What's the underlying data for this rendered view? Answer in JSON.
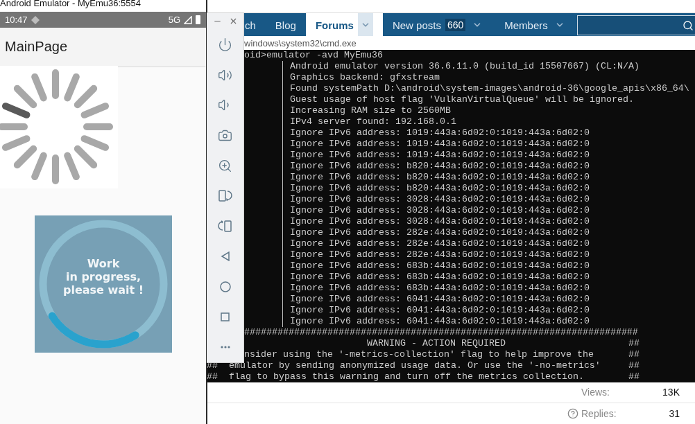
{
  "emulator": {
    "title": "Android Emulator - MyEmu36:5554",
    "status_time": "10:47",
    "network": "5G",
    "app_title": "MainPage",
    "progress_image": {
      "lines": [
        "Work",
        "in progress,",
        "please wait !"
      ]
    }
  },
  "browser": {
    "nav": [
      {
        "label": "ch",
        "selected": false,
        "dropdown": false
      },
      {
        "label": "Blog",
        "selected": false,
        "dropdown": false
      },
      {
        "label": "Forums",
        "selected": true,
        "dropdown": true
      },
      {
        "label": "New posts",
        "selected": false,
        "dropdown": true,
        "badge": "660"
      },
      {
        "label": "Members",
        "selected": false,
        "dropdown": true
      }
    ],
    "stats": [
      {
        "label": "Views:",
        "value": "13K",
        "help": false
      },
      {
        "label": "Replies:",
        "value": "31",
        "help": true
      }
    ]
  },
  "cmd": {
    "title": "windows\\system32\\cmd.exe",
    "lines": [
      {
        "kind": "command",
        "text": "oid>emulator -avd MyEmu36"
      },
      {
        "kind": "log",
        "text": "Android emulator version 36.6.11.0 (build_id 15507667) (CL:N/A)"
      },
      {
        "kind": "log",
        "text": "Graphics backend: gfxstream"
      },
      {
        "kind": "log",
        "text": "Found systemPath D:\\android\\system-images\\android-36\\google_apis\\x86_64\\"
      },
      {
        "kind": "log",
        "text": "Guest usage of host flag 'VulkanVirtualQueue' will be ignored."
      },
      {
        "kind": "log",
        "text": "Increasing RAM size to 2560MB"
      },
      {
        "kind": "log",
        "text": "IPv4 server found: 192.168.0.1"
      },
      {
        "kind": "log",
        "text": "Ignore IPv6 address: 1019:443a:6d02:0:1019:443a:6d02:0"
      },
      {
        "kind": "log",
        "text": "Ignore IPv6 address: 1019:443a:6d02:0:1019:443a:6d02:0"
      },
      {
        "kind": "log",
        "text": "Ignore IPv6 address: 1019:443a:6d02:0:1019:443a:6d02:0"
      },
      {
        "kind": "log",
        "text": "Ignore IPv6 address: b820:443a:6d02:0:1019:443a:6d02:0"
      },
      {
        "kind": "log",
        "text": "Ignore IPv6 address: b820:443a:6d02:0:1019:443a:6d02:0"
      },
      {
        "kind": "log",
        "text": "Ignore IPv6 address: b820:443a:6d02:0:1019:443a:6d02:0"
      },
      {
        "kind": "log",
        "text": "Ignore IPv6 address: 3028:443a:6d02:0:1019:443a:6d02:0"
      },
      {
        "kind": "log",
        "text": "Ignore IPv6 address: 3028:443a:6d02:0:1019:443a:6d02:0"
      },
      {
        "kind": "log",
        "text": "Ignore IPv6 address: 3028:443a:6d02:0:1019:443a:6d02:0"
      },
      {
        "kind": "log",
        "text": "Ignore IPv6 address: 282e:443a:6d02:0:1019:443a:6d02:0"
      },
      {
        "kind": "log",
        "text": "Ignore IPv6 address: 282e:443a:6d02:0:1019:443a:6d02:0"
      },
      {
        "kind": "log",
        "text": "Ignore IPv6 address: 282e:443a:6d02:0:1019:443a:6d02:0"
      },
      {
        "kind": "log",
        "text": "Ignore IPv6 address: 683b:443a:6d02:0:1019:443a:6d02:0"
      },
      {
        "kind": "log",
        "text": "Ignore IPv6 address: 683b:443a:6d02:0:1019:443a:6d02:0"
      },
      {
        "kind": "log",
        "text": "Ignore IPv6 address: 683b:443a:6d02:0:1019:443a:6d02:0"
      },
      {
        "kind": "log",
        "text": "Ignore IPv6 address: 6041:443a:6d02:0:1019:443a:6d02:0"
      },
      {
        "kind": "log",
        "text": "Ignore IPv6 address: 6041:443a:6d02:0:1019:443a:6d02:0"
      },
      {
        "kind": "log",
        "text": "Ignore IPv6 address: 6041:443a:6d02:0:1019:443a:6d02:0"
      },
      {
        "kind": "rule",
        "text": "#######################################################################"
      },
      {
        "kind": "heading",
        "text": "WARNING - ACTION REQUIRED",
        "end": "##"
      },
      {
        "kind": "banner",
        "under_toolbar": true,
        "text": "nsider using the '-metrics-collection' flag to help improve the",
        "end": "##"
      },
      {
        "kind": "banner",
        "under_toolbar": false,
        "text": "##  emulator by sending anonymized usage data. Or use the '-no-metrics'",
        "end": "##"
      },
      {
        "kind": "banner",
        "under_toolbar": false,
        "text": "##  flag to bypass this warning and turn off the metrics collection.",
        "end": "##"
      }
    ]
  }
}
